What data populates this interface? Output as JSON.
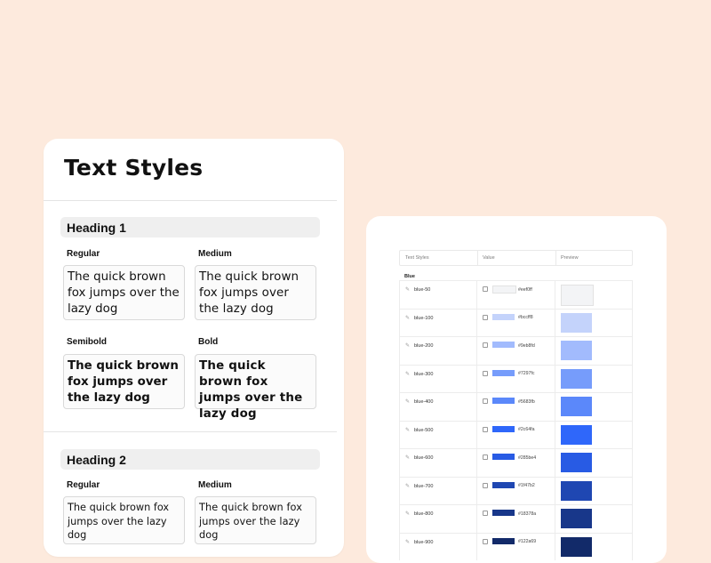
{
  "left_card": {
    "title": "Text Styles",
    "sections": [
      {
        "heading": "Heading 1",
        "weights": [
          {
            "label": "Regular",
            "sample": "The quick brown fox jumps over the lazy dog"
          },
          {
            "label": "Medium",
            "sample": "The quick brown fox jumps over the lazy dog"
          },
          {
            "label": "Semibold",
            "sample": "The quick brown fox jumps over the lazy dog"
          },
          {
            "label": "Bold",
            "sample": "The quick brown fox jumps over the lazy dog"
          }
        ]
      },
      {
        "heading": "Heading 2",
        "weights": [
          {
            "label": "Regular",
            "sample": "The quick brown fox jumps over the lazy dog"
          },
          {
            "label": "Medium",
            "sample": "The quick brown fox jumps over the lazy dog"
          }
        ]
      }
    ]
  },
  "right_card": {
    "columns": [
      "Text Styles",
      "Value",
      "Preview"
    ],
    "group": "Blue",
    "tokens": [
      {
        "name": "blue-50",
        "hex": "#eef0ff",
        "color": "#f3f4f6"
      },
      {
        "name": "blue-100",
        "hex": "#bccff8",
        "color": "#c4d3fb"
      },
      {
        "name": "blue-200",
        "hex": "#9eb8fd",
        "color": "#a2bbfd"
      },
      {
        "name": "blue-300",
        "hex": "#7297fc",
        "color": "#769cfb"
      },
      {
        "name": "blue-400",
        "hex": "#5683fb",
        "color": "#5b88fa"
      },
      {
        "name": "blue-500",
        "hex": "#2c64fa",
        "color": "#2f67fa"
      },
      {
        "name": "blue-600",
        "hex": "#285be4",
        "color": "#285be4"
      },
      {
        "name": "blue-700",
        "hex": "#1f47b2",
        "color": "#1f47b2"
      },
      {
        "name": "blue-800",
        "hex": "#18378a",
        "color": "#18378a"
      },
      {
        "name": "blue-900",
        "hex": "#122a69",
        "color": "#122a69"
      }
    ]
  }
}
